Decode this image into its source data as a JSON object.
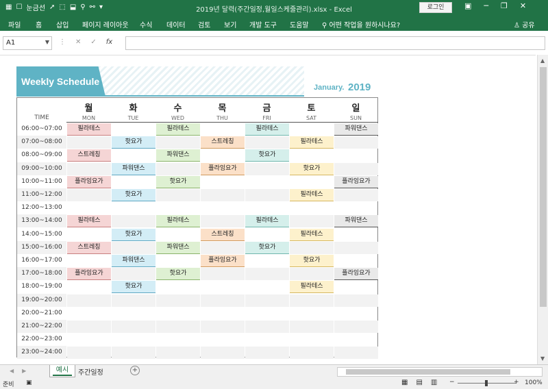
{
  "titlebar": {
    "title": "2019년 달력(주간일정,월일스케줄관리).xlsx - Excel",
    "login": "로그인",
    "qa": {
      "autosave": "눈금선"
    }
  },
  "ribbon": {
    "tabs": [
      "파일",
      "홈",
      "삽입",
      "페이지 레이아웃",
      "수식",
      "데이터",
      "검토",
      "보기",
      "개발 도구",
      "도움말"
    ],
    "tell_me": "어떤 작업을 원하시나요?",
    "share": "공유"
  },
  "formula": {
    "namebox": "A1",
    "fx": "fx",
    "content": ""
  },
  "sheet": {
    "banner_title": "Weekly Schedule",
    "month": "January.",
    "year": "2019",
    "time_header": "TIME",
    "days": [
      {
        "ko": "월",
        "en": "MON"
      },
      {
        "ko": "화",
        "en": "TUE"
      },
      {
        "ko": "수",
        "en": "WED"
      },
      {
        "ko": "목",
        "en": "THU"
      },
      {
        "ko": "금",
        "en": "FRI"
      },
      {
        "ko": "토",
        "en": "SAT"
      },
      {
        "ko": "일",
        "en": "SUN"
      }
    ],
    "rows": [
      {
        "time": "06:00~07:00",
        "cells": [
          "필라테스",
          "",
          "필라테스",
          "",
          "필라테스",
          "",
          "파워댄스"
        ]
      },
      {
        "time": "07:00~08:00",
        "cells": [
          "",
          "핫요가",
          "",
          "스트레칭",
          "",
          "필라테스",
          ""
        ]
      },
      {
        "time": "08:00~09:00",
        "cells": [
          "스트레칭",
          "",
          "파워댄스",
          "",
          "핫요가",
          "",
          ""
        ]
      },
      {
        "time": "09:00~10:00",
        "cells": [
          "",
          "파워댄스",
          "",
          "플라잉요가",
          "",
          "핫요가",
          ""
        ]
      },
      {
        "time": "10:00~11:00",
        "cells": [
          "플라잉요가",
          "",
          "핫요가",
          "",
          "",
          "",
          "플라잉요가"
        ]
      },
      {
        "time": "11:00~12:00",
        "cells": [
          "",
          "핫요가",
          "",
          "",
          "",
          "필라테스",
          ""
        ]
      },
      {
        "time": "12:00~13:00",
        "cells": [
          "",
          "",
          "",
          "",
          "",
          "",
          ""
        ]
      },
      {
        "time": "13:00~14:00",
        "cells": [
          "필라테스",
          "",
          "필라테스",
          "",
          "필라테스",
          "",
          "파워댄스"
        ]
      },
      {
        "time": "14:00~15:00",
        "cells": [
          "",
          "핫요가",
          "",
          "스트레칭",
          "",
          "필라테스",
          ""
        ]
      },
      {
        "time": "15:00~16:00",
        "cells": [
          "스트레칭",
          "",
          "파워댄스",
          "",
          "핫요가",
          "",
          ""
        ]
      },
      {
        "time": "16:00~17:00",
        "cells": [
          "",
          "파워댄스",
          "",
          "플라잉요가",
          "",
          "핫요가",
          ""
        ]
      },
      {
        "time": "17:00~18:00",
        "cells": [
          "플라잉요가",
          "",
          "핫요가",
          "",
          "",
          "",
          "플라잉요가"
        ]
      },
      {
        "time": "18:00~19:00",
        "cells": [
          "",
          "핫요가",
          "",
          "",
          "",
          "필라테스",
          ""
        ]
      },
      {
        "time": "19:00~20:00",
        "cells": [
          "",
          "",
          "",
          "",
          "",
          "",
          ""
        ]
      },
      {
        "time": "20:00~21:00",
        "cells": [
          "",
          "",
          "",
          "",
          "",
          "",
          ""
        ]
      },
      {
        "time": "21:00~22:00",
        "cells": [
          "",
          "",
          "",
          "",
          "",
          "",
          ""
        ]
      },
      {
        "time": "22:00~23:00",
        "cells": [
          "",
          "",
          "",
          "",
          "",
          "",
          ""
        ]
      },
      {
        "time": "23:00~24:00",
        "cells": [
          "",
          "",
          "",
          "",
          "",
          "",
          ""
        ]
      }
    ]
  },
  "tabs": {
    "sheet1": "예시",
    "sheet2": "주간일정"
  },
  "status": {
    "ready": "준비",
    "zoom": "100%"
  }
}
